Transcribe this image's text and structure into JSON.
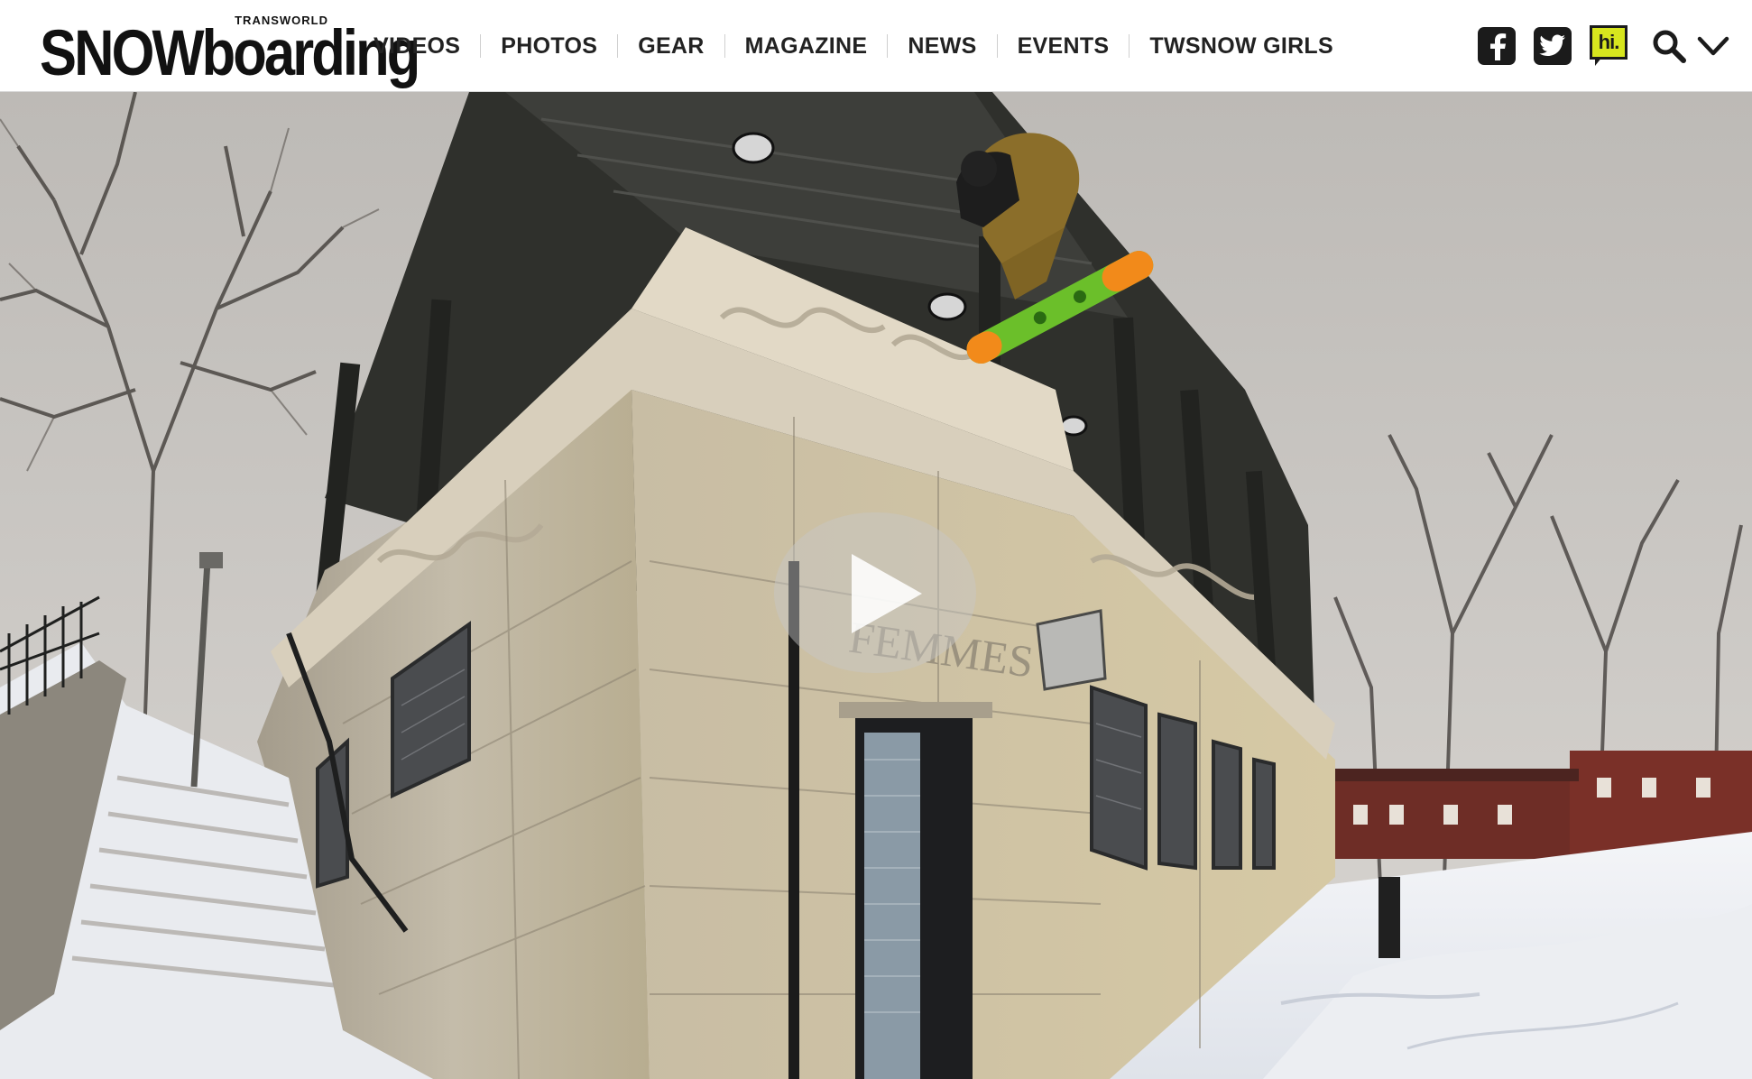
{
  "brand": {
    "top_text": "TRANSWORLD",
    "snow_text": "SNOW",
    "boarding_text": "boarding"
  },
  "nav": {
    "items": [
      {
        "label": "VIDEOS"
      },
      {
        "label": "PHOTOS"
      },
      {
        "label": "GEAR"
      },
      {
        "label": "MAGAZINE"
      },
      {
        "label": "NEWS"
      },
      {
        "label": "EVENTS"
      },
      {
        "label": "TWSNOW GIRLS"
      }
    ]
  },
  "header_icons": {
    "facebook": "facebook-icon",
    "twitter": "twitter-icon",
    "hi": "hi.",
    "search": "search-icon",
    "menu": "chevron-down-icon"
  },
  "hero": {
    "engraved_text": "FEMMES",
    "play": "play-icon"
  },
  "colors": {
    "nav_text": "#222222",
    "icon_bg": "#1b1b1b",
    "hi_accent": "#d7e61e",
    "board_green": "#6bbf2a",
    "board_orange": "#f28a1a"
  }
}
